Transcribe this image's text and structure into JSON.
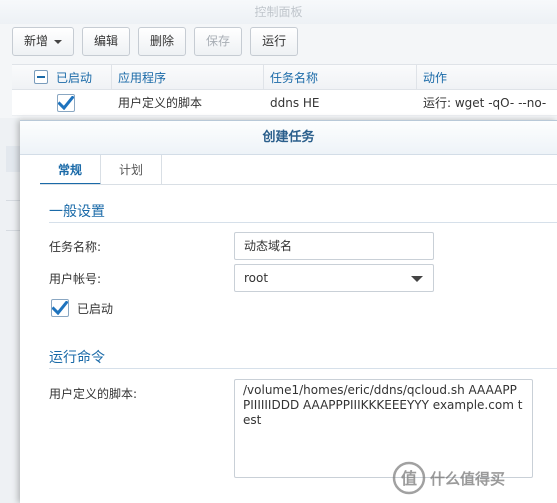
{
  "panel": {
    "title": "控制面板",
    "toolbar": {
      "add_label": "新增",
      "edit_label": "编辑",
      "delete_label": "删除",
      "save_label": "保存",
      "run_label": "运行"
    },
    "table": {
      "columns": [
        "已启动",
        "应用程序",
        "任务名称",
        "动作"
      ],
      "rows": [
        {
          "enabled": true,
          "app": "用户定义的脚本",
          "task": "ddns HE",
          "action": "运行: wget -qO- --no-"
        }
      ]
    }
  },
  "dialog": {
    "title": "创建任务",
    "tabs": [
      "常规",
      "计划"
    ],
    "active_tab": "常规",
    "general_section_title": "一般设置",
    "task_name_label": "任务名称:",
    "task_name_value": "动态域名",
    "user_label": "用户帐号:",
    "user_value": "root",
    "enabled_label": "已启动",
    "enabled": true,
    "run_section_title": "运行命令",
    "script_label": "用户定义的脚本:",
    "script_value": "/volume1/homes/eric/ddns/qcloud.sh AAAAPPPIIIIIIDDD AAAPPPIIIKKKEEEYYY example.com test"
  },
  "watermark": {
    "text": "什么值得买",
    "icon": "zhi-logo-icon"
  },
  "colors": {
    "accent": "#1a6aa8",
    "check": "#1e73be"
  }
}
